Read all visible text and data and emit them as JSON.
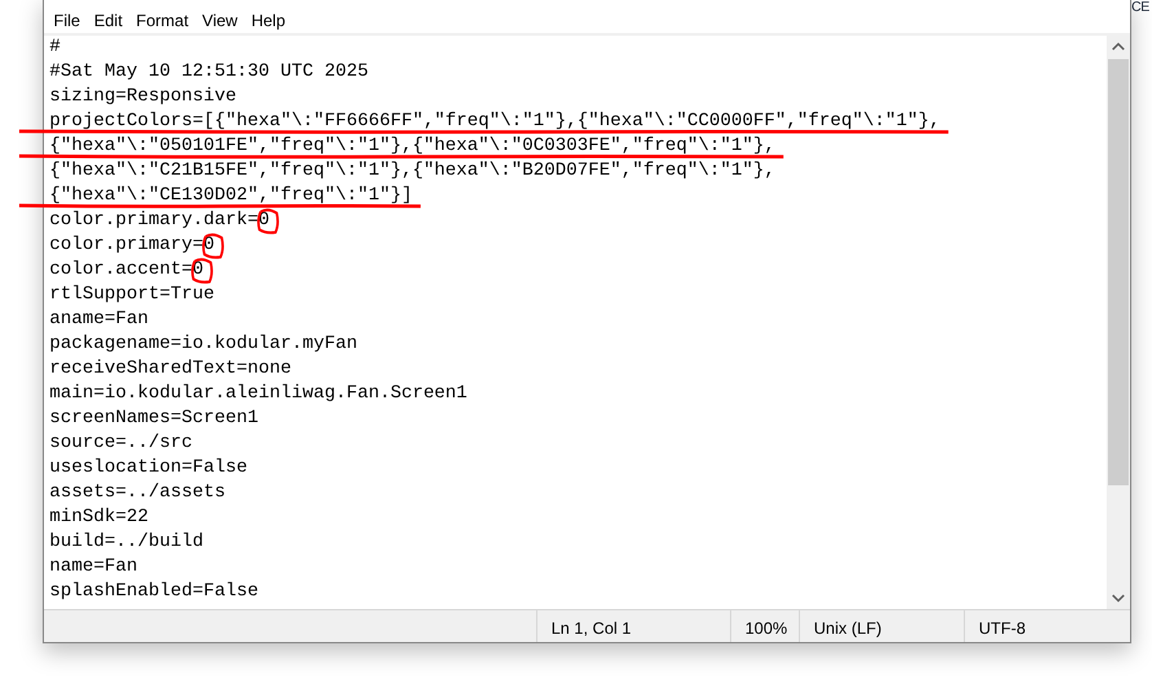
{
  "corner_text": "CE",
  "menu": [
    "File",
    "Edit",
    "Format",
    "View",
    "Help"
  ],
  "lines": [
    {
      "text": "#",
      "struck": false,
      "circled": false
    },
    {
      "text": "#Sat May 10 12:51:30 UTC 2025",
      "struck": false,
      "circled": false
    },
    {
      "text": "sizing=Responsive",
      "struck": false,
      "circled": false
    },
    {
      "text": "projectColors=[{\"hexa\"\\:\"FF6666FF\",\"freq\"\\:\"1\"},{\"hexa\"\\:\"CC0000FF\",\"freq\"\\:\"1\"},",
      "struck": true,
      "circled": false
    },
    {
      "text": "{\"hexa\"\\:\"050101FE\",\"freq\"\\:\"1\"},{\"hexa\"\\:\"0C0303FE\",\"freq\"\\:\"1\"},",
      "struck": true,
      "circled": false
    },
    {
      "text": "{\"hexa\"\\:\"C21B15FE\",\"freq\"\\:\"1\"},{\"hexa\"\\:\"B20D07FE\",\"freq\"\\:\"1\"},",
      "struck": false,
      "circled": false
    },
    {
      "text": "{\"hexa\"\\:\"CE130D02\",\"freq\"\\:\"1\"}]",
      "struck": true,
      "circled": false
    },
    {
      "text": "color.primary.dark=0",
      "struck": false,
      "circled": true
    },
    {
      "text": "color.primary=0",
      "struck": false,
      "circled": true
    },
    {
      "text": "color.accent=0",
      "struck": false,
      "circled": true
    },
    {
      "text": "rtlSupport=True",
      "struck": false,
      "circled": false
    },
    {
      "text": "aname=Fan",
      "struck": false,
      "circled": false
    },
    {
      "text": "packagename=io.kodular.myFan",
      "struck": false,
      "circled": false
    },
    {
      "text": "receiveSharedText=none",
      "struck": false,
      "circled": false
    },
    {
      "text": "main=io.kodular.aleinliwag.Fan.Screen1",
      "struck": false,
      "circled": false
    },
    {
      "text": "screenNames=Screen1",
      "struck": false,
      "circled": false
    },
    {
      "text": "source=../src",
      "struck": false,
      "circled": false
    },
    {
      "text": "useslocation=False",
      "struck": false,
      "circled": false
    },
    {
      "text": "assets=../assets",
      "struck": false,
      "circled": false
    },
    {
      "text": "minSdk=22",
      "struck": false,
      "circled": false
    },
    {
      "text": "build=../build",
      "struck": false,
      "circled": false
    },
    {
      "text": "name=Fan",
      "struck": false,
      "circled": false
    },
    {
      "text": "splashEnabled=False",
      "struck": false,
      "circled": false
    }
  ],
  "status_bar": [
    "Ln 1, Col 1",
    "100%",
    "Unix (LF)",
    "UTF-8"
  ]
}
